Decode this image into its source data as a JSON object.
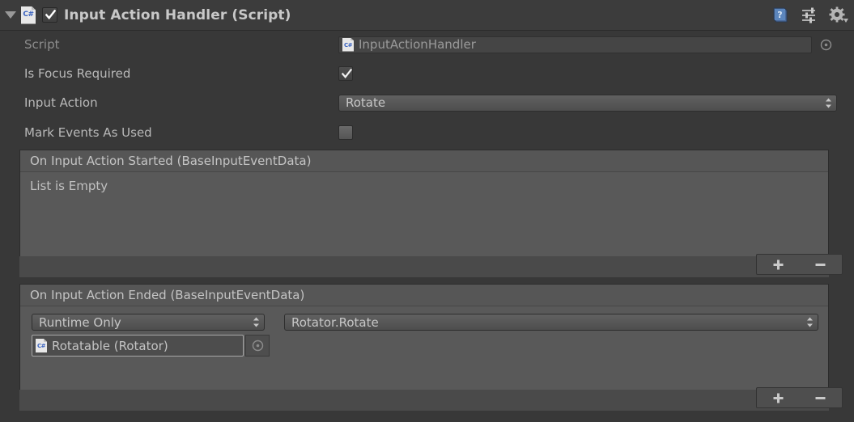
{
  "component": {
    "title": "Input Action Handler (Script)",
    "enabled_checkbox": true,
    "foldout_expanded": true,
    "script_icon": "csharp-script-icon",
    "header_icons": [
      "help-icon",
      "preset-icon",
      "gear-icon"
    ]
  },
  "properties": [
    {
      "label": "Script",
      "type": "object-field",
      "value": "InputActionHandler",
      "icon": "csharp-script-icon",
      "picker": "object-picker-icon",
      "disabled": true
    },
    {
      "label": "Is Focus Required",
      "type": "checkbox",
      "checked": true
    },
    {
      "label": "Input Action",
      "type": "popup",
      "value": "Rotate"
    },
    {
      "label": "Mark Events As Used",
      "type": "checkbox",
      "checked": false
    }
  ],
  "events": [
    {
      "title": "On Input Action Started (BaseInputEventData)",
      "empty_text": "List is Empty",
      "entries": [],
      "add_label": "+",
      "remove_label": "–"
    },
    {
      "title": "On Input Action Ended (BaseInputEventData)",
      "empty_text": "",
      "entries": [
        {
          "call_state": "Runtime Only",
          "method": "Rotator.Rotate",
          "target_object": "Rotatable (Rotator)",
          "target_icon": "csharp-script-icon",
          "target_picker": "object-picker-icon"
        }
      ],
      "add_label": "+",
      "remove_label": "–"
    }
  ],
  "colors": {
    "background": "#383838",
    "header_bg": "#3c3c3c",
    "event_title_bg": "#565656",
    "event_body_bg": "#595959",
    "text": "#b9b9b9",
    "dim_text": "#8d8d8d",
    "csharp_blue": "#3a63c0"
  }
}
